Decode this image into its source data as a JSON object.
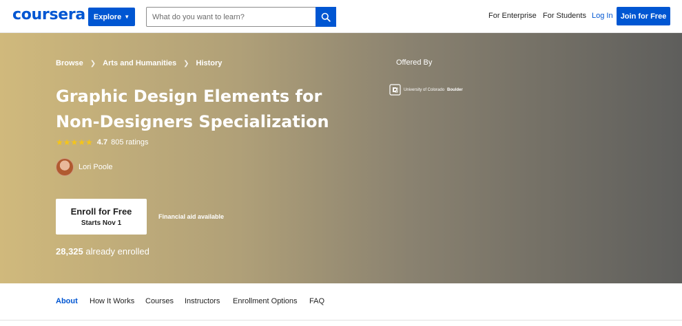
{
  "header": {
    "logo": "coursera",
    "explore_label": "Explore",
    "search": {
      "placeholder": "What do you want to learn?",
      "value": ""
    },
    "nav": {
      "enterprise": "For Enterprise",
      "students": "For Students",
      "login": "Log In",
      "join": "Join for Free"
    }
  },
  "hero": {
    "breadcrumb": [
      "Browse",
      "Arts and Humanities",
      "History"
    ],
    "title_line1": "Graphic Design Elements for",
    "title_line2": "Non-Designers Specialization",
    "rating": {
      "value": "4.7",
      "count": "805 ratings",
      "stars": 4.7
    },
    "instructor": "Lori Poole",
    "enroll": {
      "main": "Enroll for Free",
      "sub": "Starts Nov 1"
    },
    "financial_aid": "Financial aid available",
    "enrolled_count": "28,325",
    "enrolled_suffix": "already enrolled",
    "offered_by": "Offered By",
    "university": {
      "prefix": "University of Colorado",
      "bold": "Boulder"
    }
  },
  "tabs": [
    "About",
    "How It Works",
    "Courses",
    "Instructors",
    "Enrollment Options",
    "FAQ"
  ],
  "colors": {
    "brand": "#0056d2",
    "star": "#f5c518",
    "hero_start": "#d0b97c",
    "hero_end": "#5e5e5c"
  },
  "icons": {
    "search": "search-icon",
    "explore_chevron": "chevron-down-icon",
    "breadcrumb_sep": "chevron-right-icon"
  }
}
